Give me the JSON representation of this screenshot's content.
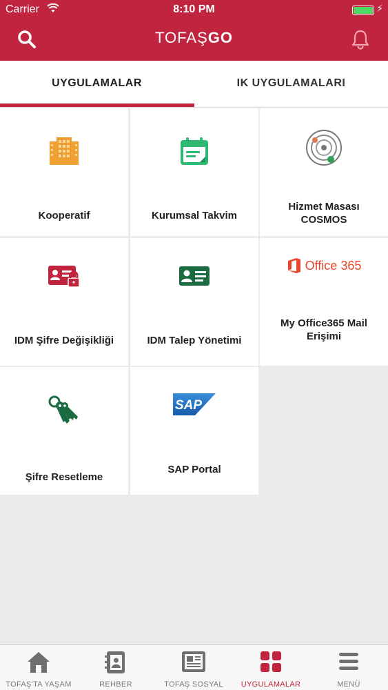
{
  "status_bar": {
    "carrier": "Carrier",
    "time": "8:10 PM"
  },
  "header": {
    "logo_part1": "TOFAŞ",
    "logo_part2": "GO"
  },
  "tabs": [
    {
      "label": "UYGULAMALAR",
      "active": true
    },
    {
      "label": "IK UYGULAMALARI",
      "active": false
    }
  ],
  "apps": [
    {
      "label": "Kooperatif",
      "icon": "building-icon"
    },
    {
      "label": "Kurumsal Takvim",
      "icon": "calendar-icon"
    },
    {
      "label_line1": "Hizmet Masası",
      "label_line2": "COSMOS",
      "icon": "cosmos-orbit-icon"
    },
    {
      "label": "IDM Şifre Değişikliği",
      "icon": "id-card-lock-icon"
    },
    {
      "label": "IDM Talep Yönetimi",
      "icon": "id-card-icon"
    },
    {
      "label_line1": "My Office365 Mail",
      "label_line2": "Erişimi",
      "logo_text": "Office 365",
      "icon": "office365-icon"
    },
    {
      "label": "Şifre Resetleme",
      "icon": "keys-icon"
    },
    {
      "label": "SAP Portal",
      "logo_text": "SAP",
      "icon": "sap-logo-icon"
    }
  ],
  "bottom_nav": [
    {
      "label": "TOFAŞ'TA YAŞAM",
      "icon": "home-icon",
      "active": false
    },
    {
      "label": "REHBER",
      "icon": "contacts-book-icon",
      "active": false
    },
    {
      "label": "TOFAŞ SOSYAL",
      "icon": "newspaper-icon",
      "active": false
    },
    {
      "label": "UYGULAMALAR",
      "icon": "apps-grid-icon",
      "active": true
    },
    {
      "label": "MENÜ",
      "icon": "hamburger-menu-icon",
      "active": false
    }
  ],
  "colors": {
    "brand": "#c0243f",
    "kooperatif_orange": "#f0a030",
    "calendar_green": "#2eb872",
    "idm_red": "#c0243f",
    "idm_green": "#1a6b3f",
    "office_red": "#e8472b",
    "sap_blue": "#1d6fc0"
  }
}
